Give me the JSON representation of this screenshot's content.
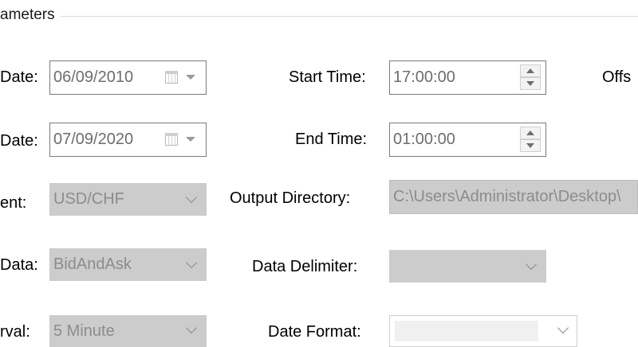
{
  "group": {
    "title": "ameters"
  },
  "left": {
    "start_date": {
      "label": "Date:",
      "value": "06/09/2010"
    },
    "end_date": {
      "label": "Date:",
      "value": "07/09/2020"
    },
    "instrument": {
      "label": "ent:",
      "value": "USD/CHF"
    },
    "data": {
      "label": "Data:",
      "value": "BidAndAsk"
    },
    "interval": {
      "label": "rval:",
      "value": "5 Minute"
    }
  },
  "middle": {
    "start_time": {
      "label": "Start Time:",
      "value": "17:00:00"
    },
    "end_time": {
      "label": "End Time:",
      "value": "01:00:00"
    },
    "output_directory": {
      "label": "Output Directory:",
      "value": "C:\\Users\\Administrator\\Desktop\\"
    },
    "data_delimiter": {
      "label": "Data Delimiter:",
      "value": ""
    },
    "date_format": {
      "label": "Date Format:",
      "value": ""
    }
  },
  "right": {
    "offset_label": "Offs"
  },
  "icons": {
    "calendar": "calendar-icon",
    "dropdown": "chevron-down-icon",
    "spin_up": "spin-up-icon",
    "spin_down": "spin-down-icon"
  }
}
